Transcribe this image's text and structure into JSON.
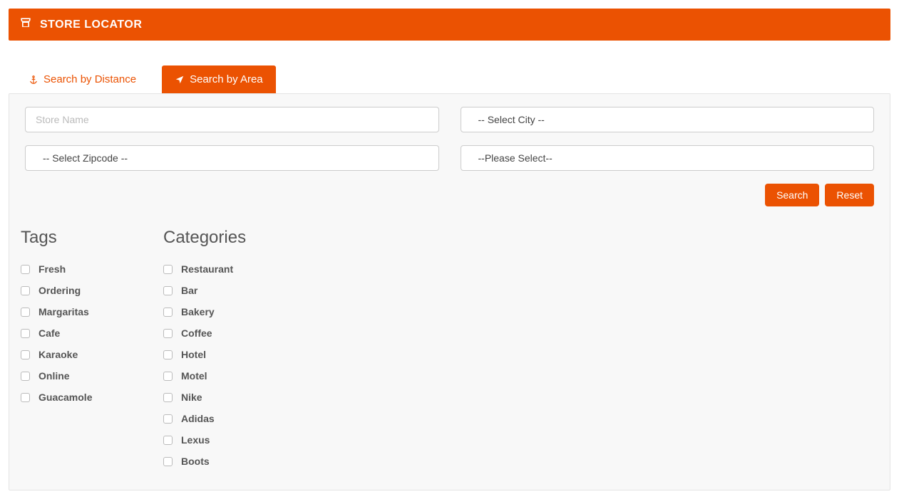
{
  "header": {
    "title": "STORE LOCATOR"
  },
  "tabs": {
    "distance": "Search by Distance",
    "area": "Search by Area"
  },
  "form": {
    "storeNamePlaceholder": "Store Name",
    "citySelect": "-- Select City --",
    "zipcodeSelect": "-- Select Zipcode --",
    "genericSelect": "--Please Select--",
    "searchBtn": "Search",
    "resetBtn": "Reset"
  },
  "filters": {
    "tagsHeading": "Tags",
    "categoriesHeading": "Categories",
    "tags": [
      {
        "label": "Fresh"
      },
      {
        "label": "Ordering"
      },
      {
        "label": "Margaritas"
      },
      {
        "label": "Cafe"
      },
      {
        "label": "Karaoke"
      },
      {
        "label": "Online"
      },
      {
        "label": "Guacamole"
      }
    ],
    "categories": [
      {
        "label": "Restaurant"
      },
      {
        "label": "Bar"
      },
      {
        "label": "Bakery"
      },
      {
        "label": "Coffee"
      },
      {
        "label": "Hotel"
      },
      {
        "label": "Motel"
      },
      {
        "label": "Nike"
      },
      {
        "label": "Adidas"
      },
      {
        "label": "Lexus"
      },
      {
        "label": "Boots"
      }
    ]
  }
}
